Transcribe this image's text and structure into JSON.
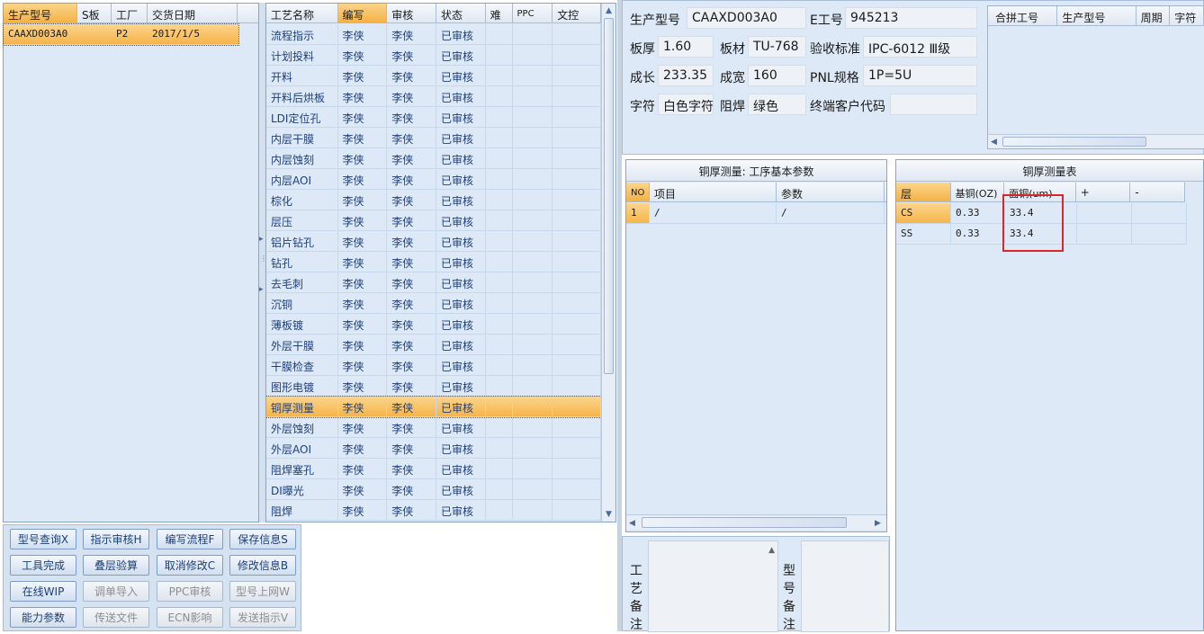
{
  "order_grid": {
    "columns": [
      "生产型号",
      "S板",
      "工厂",
      "交货日期"
    ],
    "rows": [
      {
        "model": "CAAXD003A0",
        "s": "",
        "factory": "P2",
        "date": "2017/1/5"
      }
    ]
  },
  "process_grid": {
    "columns": [
      "工艺名称",
      "编写",
      "审核",
      "状态",
      "难",
      "PPC",
      "文控"
    ],
    "selected_index": 18,
    "rows": [
      [
        "流程指示",
        "李侠",
        "李侠",
        "已审核"
      ],
      [
        "计划投料",
        "李侠",
        "李侠",
        "已审核"
      ],
      [
        "开料",
        "李侠",
        "李侠",
        "已审核"
      ],
      [
        "开料后烘板",
        "李侠",
        "李侠",
        "已审核"
      ],
      [
        "LDI定位孔",
        "李侠",
        "李侠",
        "已审核"
      ],
      [
        "内层干膜",
        "李侠",
        "李侠",
        "已审核"
      ],
      [
        "内层蚀刻",
        "李侠",
        "李侠",
        "已审核"
      ],
      [
        "内层AOI",
        "李侠",
        "李侠",
        "已审核"
      ],
      [
        "棕化",
        "李侠",
        "李侠",
        "已审核"
      ],
      [
        "层压",
        "李侠",
        "李侠",
        "已审核"
      ],
      [
        "铝片钻孔",
        "李侠",
        "李侠",
        "已审核"
      ],
      [
        "钻孔",
        "李侠",
        "李侠",
        "已审核"
      ],
      [
        "去毛刺",
        "李侠",
        "李侠",
        "已审核"
      ],
      [
        "沉铜",
        "李侠",
        "李侠",
        "已审核"
      ],
      [
        "薄板镀",
        "李侠",
        "李侠",
        "已审核"
      ],
      [
        "外层干膜",
        "李侠",
        "李侠",
        "已审核"
      ],
      [
        "干膜检查",
        "李侠",
        "李侠",
        "已审核"
      ],
      [
        "图形电镀",
        "李侠",
        "李侠",
        "已审核"
      ],
      [
        "铜厚测量",
        "李侠",
        "李侠",
        "已审核"
      ],
      [
        "外层蚀刻",
        "李侠",
        "李侠",
        "已审核"
      ],
      [
        "外层AOI",
        "李侠",
        "李侠",
        "已审核"
      ],
      [
        "阻焊塞孔",
        "李侠",
        "李侠",
        "已审核"
      ],
      [
        "DI曝光",
        "李侠",
        "李侠",
        "已审核"
      ],
      [
        "阻焊",
        "李侠",
        "李侠",
        "已审核"
      ]
    ]
  },
  "buttons": {
    "model_query": "型号查询X",
    "instruction_review": "指示审核H",
    "write_flow": "编写流程F",
    "save_info": "保存信息S",
    "tool_done": "工具完成",
    "stack_check": "叠层验算",
    "cancel_edit": "取消修改C",
    "edit_info": "修改信息B",
    "online_wip": "在线WIP",
    "order_import": "调单导入",
    "ppc_review": "PPC审核",
    "model_online": "型号上网W",
    "capability": "能力参数",
    "send_file": "传送文件",
    "ecn_impact": "ECN影响",
    "send_instruction": "发送指示V"
  },
  "info": {
    "model_label": "生产型号",
    "model_value": "CAAXD003A0",
    "e_no_label": "E工号",
    "e_no_value": "945213",
    "thickness_label": "板厚",
    "thickness_value": "1.60",
    "material_label": "板材",
    "material_value": "TU-768",
    "accept_label": "验收标准",
    "accept_value": "IPC-6012 Ⅲ级",
    "length_label": "成长",
    "length_value": "233.35",
    "width_label": "成宽",
    "width_value": "160",
    "pnl_label": "PNL规格",
    "pnl_value": "1P=5U",
    "char_label": "字符",
    "char_value": "白色字符",
    "mask_label": "阻焊",
    "mask_value": "绿色",
    "customer_label": "终端客户代码",
    "customer_value": ""
  },
  "merge_grid": {
    "columns": [
      "合拼工号",
      "生产型号",
      "周期",
      "字符"
    ]
  },
  "param_panel": {
    "title": "铜厚测量: 工序基本参数",
    "columns": [
      "NO",
      "项目",
      "参数"
    ],
    "rows": [
      [
        "1",
        "/",
        "/"
      ]
    ]
  },
  "measure_panel": {
    "title": "铜厚测量表",
    "columns": [
      "层",
      "基铜(OZ)",
      "面铜(um)",
      "+",
      "-"
    ],
    "rows": [
      [
        "CS",
        "0.33",
        "33.4",
        "",
        ""
      ],
      [
        "SS",
        "0.33",
        "33.4",
        "",
        ""
      ]
    ]
  },
  "notes": {
    "process_note_label": "工艺备注",
    "model_note_label": "型号备注"
  },
  "colors": {
    "selection": "#f6b44b",
    "highlight_box": "#d9262b",
    "panel_bg": "#dde9f7"
  }
}
